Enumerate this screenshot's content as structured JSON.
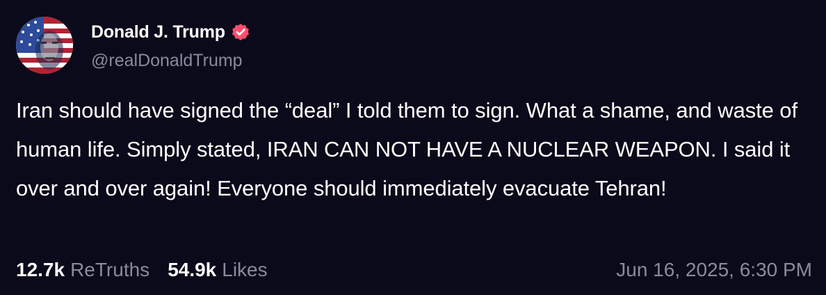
{
  "author": {
    "display_name": "Donald J. Trump",
    "handle": "@realDonaldTrump",
    "verified": true,
    "verified_color": "#ff4d6d"
  },
  "post": {
    "text": "Iran should have signed the “deal” I told them to sign. What a shame, and waste of human life. Simply stated, IRAN CAN NOT HAVE A NUCLEAR WEAPON. I said it over and over again! Everyone should immediately evacuate Tehran!"
  },
  "stats": {
    "retruths_count": "12.7k",
    "retruths_label": "ReTruths",
    "likes_count": "54.9k",
    "likes_label": "Likes"
  },
  "timestamp": "Jun 16, 2025, 6:30 PM",
  "colors": {
    "background": "#0b0a1a",
    "text_primary": "#ffffff",
    "text_secondary": "#8b8a9c"
  }
}
